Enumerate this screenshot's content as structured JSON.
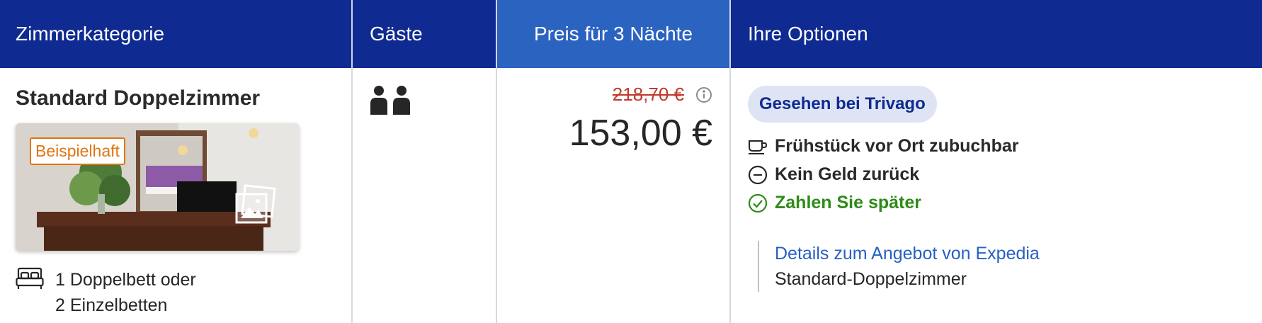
{
  "header": {
    "room_category": "Zimmerkategorie",
    "guests": "Gäste",
    "price": "Preis für 3 Nächte",
    "options": "Ihre Optionen"
  },
  "room": {
    "title": "Standard Doppelzimmer",
    "photo_badge": "Beispielhaft",
    "bed_line1": "1 Doppelbett oder",
    "bed_line2": "2 Einzelbetten"
  },
  "guests": {
    "count": 2,
    "icon": "two-persons-icon"
  },
  "price": {
    "old": "218,70 €",
    "new": "153,00 €"
  },
  "options": {
    "seen_badge": "Gesehen bei Trivago",
    "items": [
      {
        "label": "Frühstück vor Ort zubuchbar",
        "icon": "coffee-cup-icon"
      },
      {
        "label": "Kein Geld zurück",
        "icon": "minus-circle-icon"
      },
      {
        "label": "Zahlen Sie später",
        "icon": "check-circle-icon"
      }
    ],
    "details_link": "Details zum Angebot von Expedia",
    "details_sub": "Standard-Doppelzimmer"
  },
  "colors": {
    "header_bg": "#0f2b91",
    "header_active_bg": "#2b63c0",
    "old_price": "#c0392b",
    "positive": "#2e8b18",
    "link": "#2760c4",
    "badge_orange": "#e07512"
  }
}
